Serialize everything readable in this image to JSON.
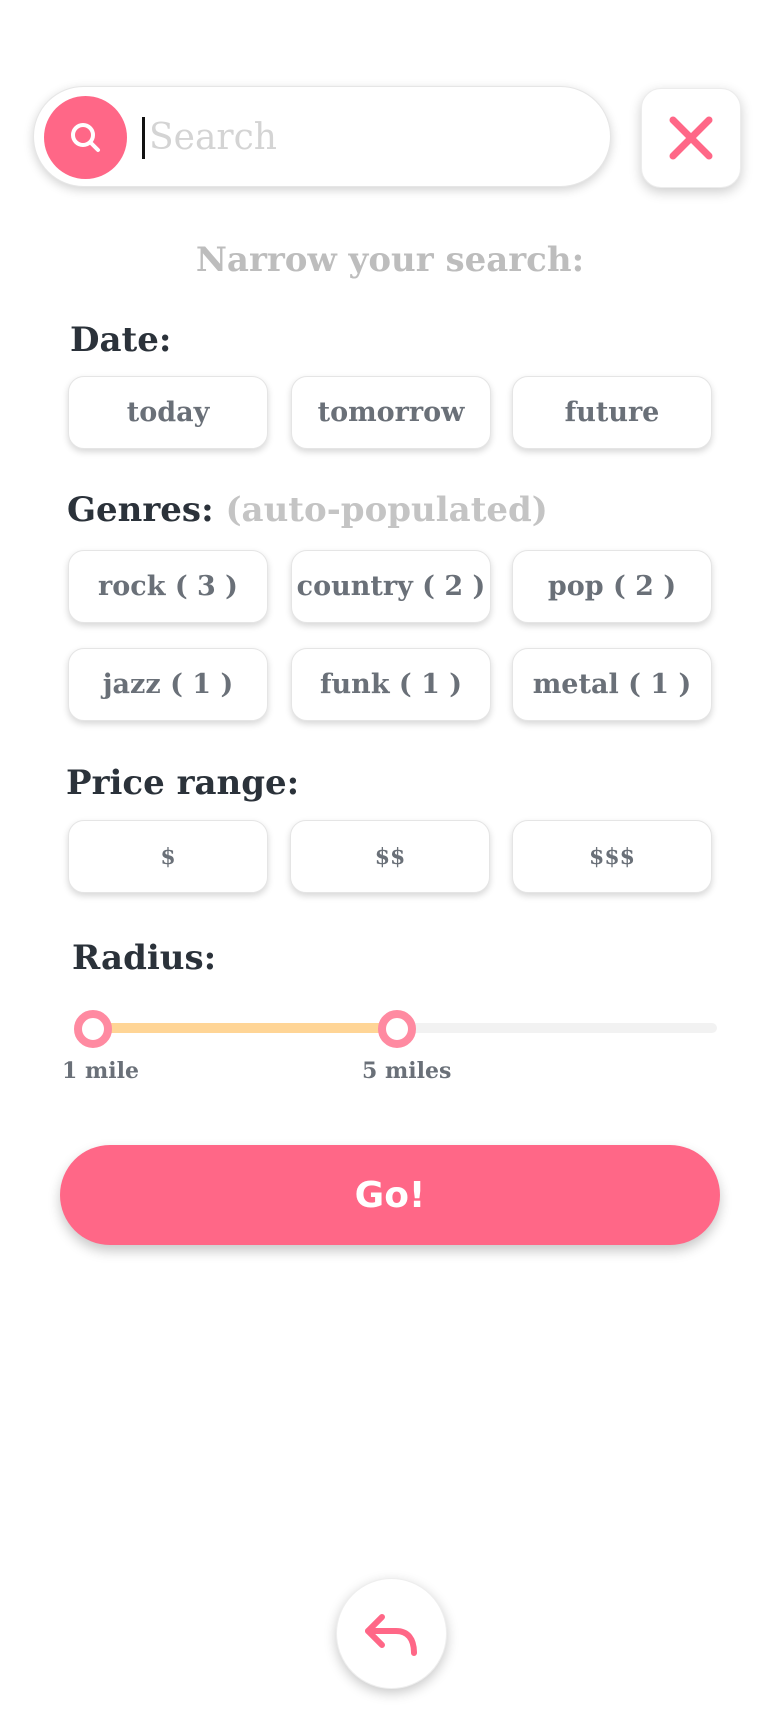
{
  "search": {
    "placeholder": "Search",
    "value": ""
  },
  "subtitle": "Narrow your search:",
  "date": {
    "label": "Date:",
    "options": [
      "today",
      "tomorrow",
      "future"
    ]
  },
  "genres": {
    "label": "Genres:",
    "note": "(auto-populated)",
    "options": [
      "rock ( 3 )",
      "country ( 2 )",
      "pop ( 2 )",
      "jazz ( 1 )",
      "funk ( 1 )",
      "metal ( 1 )"
    ]
  },
  "price": {
    "label": "Price range:",
    "options": [
      "$",
      "$$",
      "$$$"
    ]
  },
  "radius": {
    "label": "Radius:",
    "min_label": "1 mile",
    "max_label": "5 miles"
  },
  "go_label": "Go!",
  "colors": {
    "accent": "#ff6787",
    "slider_fill": "#ffd596",
    "slider_thumb": "#ff8aa1",
    "muted_text": "#bdbdbd",
    "label_text": "#2b323a"
  },
  "icons": {
    "search": "search-icon",
    "close": "close-icon",
    "back": "back-arrow-icon"
  }
}
